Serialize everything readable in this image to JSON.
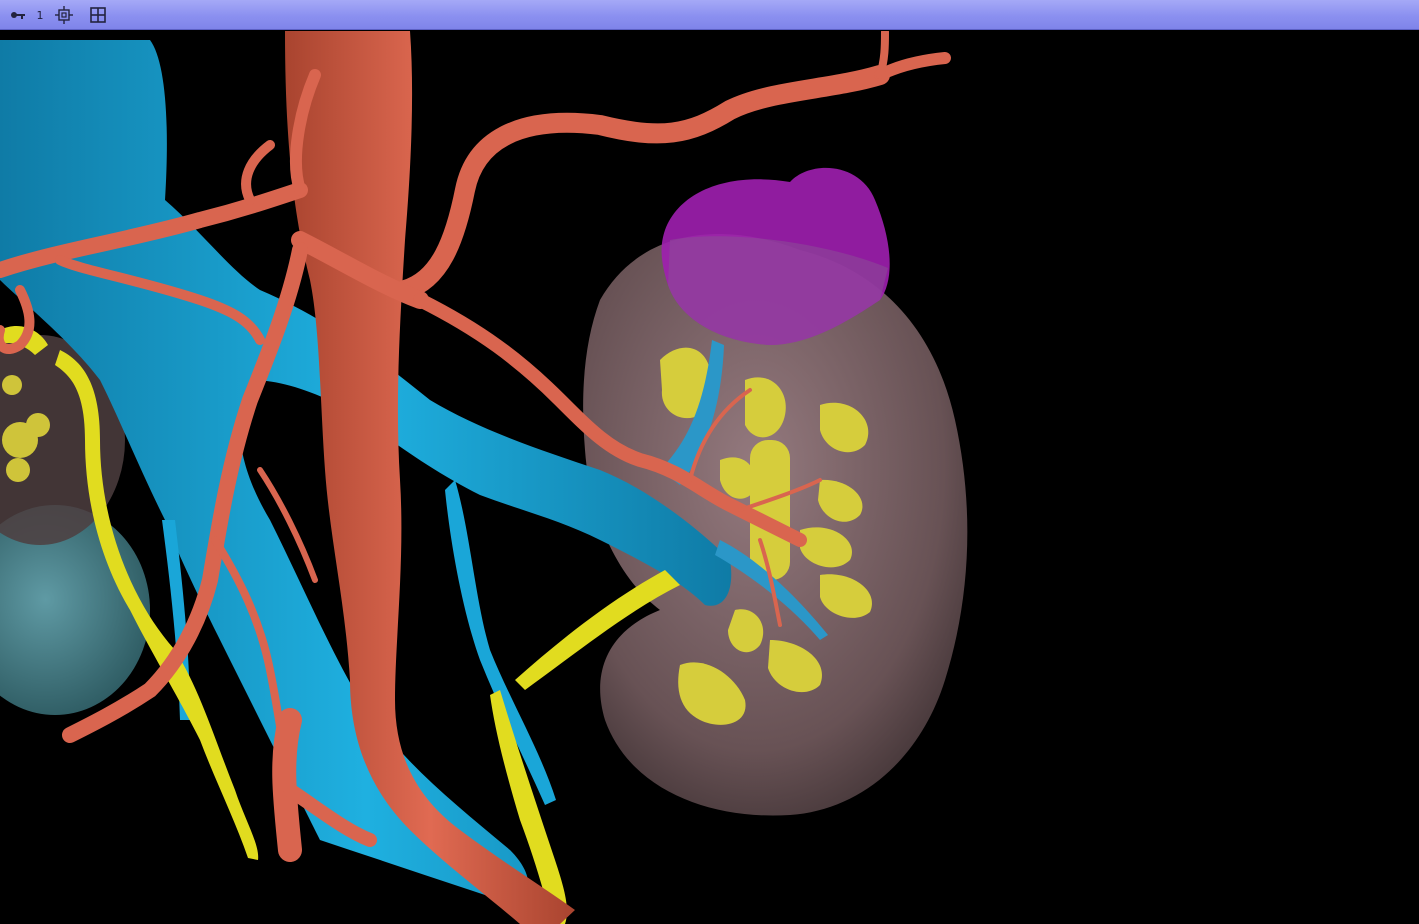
{
  "toolbar": {
    "items": [
      {
        "name": "pin-icon",
        "icon": "pin"
      },
      {
        "name": "view-number",
        "label": "1"
      },
      {
        "name": "center-view-icon",
        "icon": "crosshair"
      },
      {
        "name": "layout-icon",
        "icon": "grid-2x2"
      }
    ],
    "background_color": "#8b90f0"
  },
  "viewport": {
    "background_color": "#000000",
    "structures": [
      {
        "name": "kidney",
        "color": "#8e7478"
      },
      {
        "name": "adrenal-tumor",
        "color": "#a020b0"
      },
      {
        "name": "aorta",
        "color": "#d9654f"
      },
      {
        "name": "vena-cava",
        "color": "#1aa6d8"
      },
      {
        "name": "renal-calyces",
        "color": "#d8d03a"
      },
      {
        "name": "ureter",
        "color": "#e0de20"
      },
      {
        "name": "cyst",
        "color": "#4f8d98"
      }
    ]
  }
}
